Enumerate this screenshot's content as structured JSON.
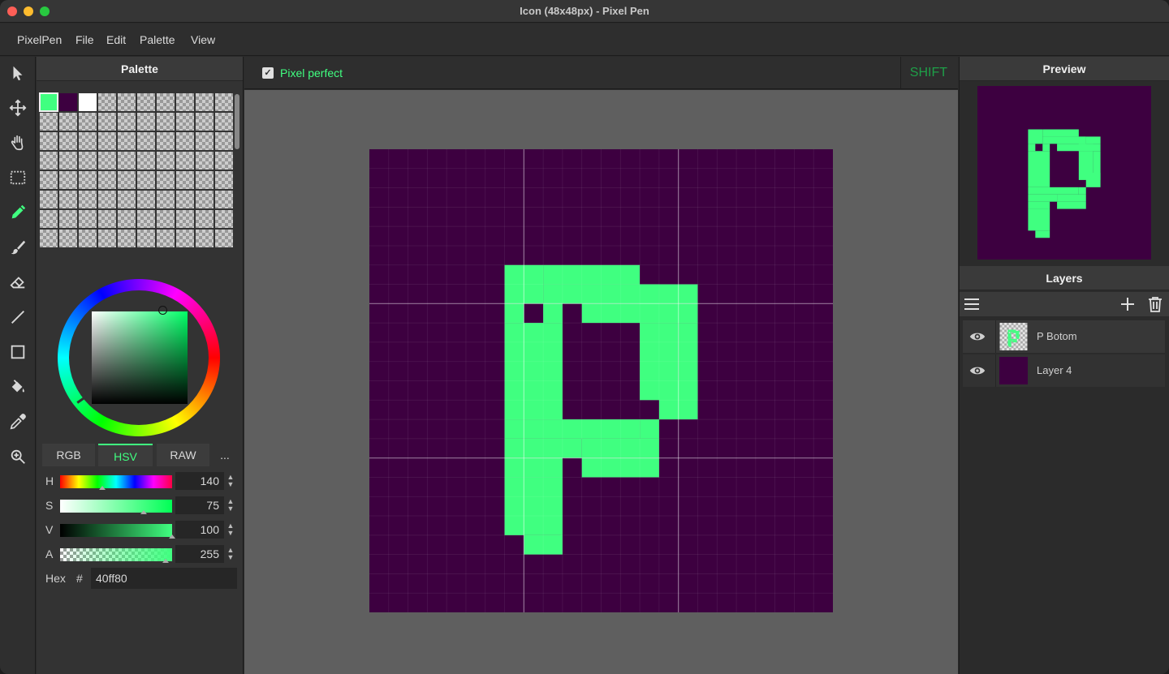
{
  "window": {
    "title": "Icon (48x48px) - Pixel Pen"
  },
  "menu": {
    "items": [
      "PixelPen",
      "File",
      "Edit",
      "Palette",
      "View"
    ]
  },
  "tools": [
    "select-tool",
    "move-tool",
    "pan-tool",
    "marquee-tool",
    "pen-tool",
    "brush-tool",
    "eraser-tool",
    "line-tool",
    "rectangle-tool",
    "fill-tool",
    "eyedropper-tool",
    "zoom-tool"
  ],
  "palette": {
    "title": "Palette",
    "colors": [
      "#40ff80",
      "#3d0040",
      "#ffffff"
    ],
    "selected_index": 0
  },
  "color_picker": {
    "tabs": [
      "RGB",
      "HSV",
      "RAW",
      "..."
    ],
    "active_tab": "HSV",
    "sliders": [
      {
        "label": "H",
        "value": "140"
      },
      {
        "label": "S",
        "value": "75"
      },
      {
        "label": "V",
        "value": "100"
      },
      {
        "label": "A",
        "value": "255"
      }
    ],
    "hex_label": "Hex",
    "hash": "#",
    "hex_value": "40ff80"
  },
  "canvas": {
    "pixel_perfect_label": "Pixel perfect",
    "pixel_perfect_checked": true,
    "checkmark": "✓",
    "shift_label": "SHIFT",
    "background_color": "#3d0040",
    "foreground_color": "#40ff80",
    "grid_cols": 24
  },
  "preview": {
    "title": "Preview"
  },
  "layers": {
    "title": "Layers",
    "items": [
      {
        "name": "P Botom",
        "visible": true,
        "active": true
      },
      {
        "name": "Layer 4",
        "visible": true,
        "active": false
      }
    ]
  }
}
